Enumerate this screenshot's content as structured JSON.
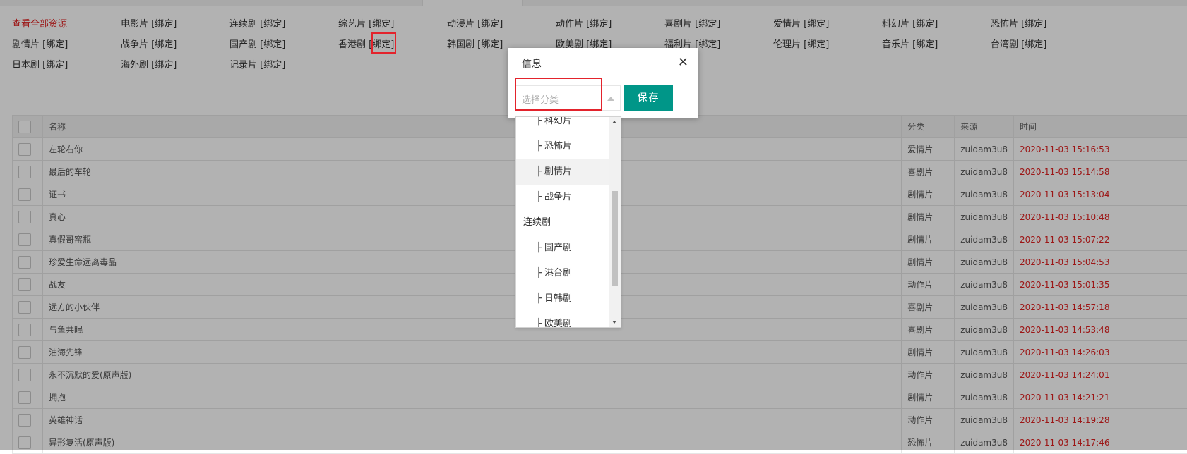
{
  "categories": [
    {
      "name": "查看全部资源",
      "bind": "",
      "active": true
    },
    {
      "name": "电影片",
      "bind": "[绑定]"
    },
    {
      "name": "连续剧",
      "bind": "[绑定]"
    },
    {
      "name": "综艺片",
      "bind": "[绑定]"
    },
    {
      "name": "动漫片",
      "bind": "[绑定]"
    },
    {
      "name": "动作片",
      "bind": "[绑定]"
    },
    {
      "name": "喜剧片",
      "bind": "[绑定]"
    },
    {
      "name": "爱情片",
      "bind": "[绑定]"
    },
    {
      "name": "科幻片",
      "bind": "[绑定]"
    },
    {
      "name": "恐怖片",
      "bind": "[绑定]"
    },
    {
      "name": "剧情片",
      "bind": "[绑定]"
    },
    {
      "name": "战争片",
      "bind": "[绑定]"
    },
    {
      "name": "国产剧",
      "bind": "[绑定]"
    },
    {
      "name": "香港剧",
      "bind": "[绑定]"
    },
    {
      "name": "韩国剧",
      "bind": "[绑定]"
    },
    {
      "name": "欧美剧",
      "bind": "[绑定]"
    },
    {
      "name": "福利片",
      "bind": "[绑定]"
    },
    {
      "name": "伦理片",
      "bind": "[绑定]"
    },
    {
      "name": "音乐片",
      "bind": "[绑定]"
    },
    {
      "name": "台湾剧",
      "bind": "[绑定]"
    },
    {
      "name": "日本剧",
      "bind": "[绑定]"
    },
    {
      "name": "海外剧",
      "bind": "[绑定]"
    },
    {
      "name": "记录片",
      "bind": "[绑定]"
    }
  ],
  "table": {
    "headers": {
      "name": "名称",
      "category": "分类",
      "source": "来源",
      "time": "时间"
    },
    "rows": [
      {
        "name": "左轮右你",
        "category": "爱情片",
        "source": "zuidam3u8",
        "time": "2020-11-03 15:16:53"
      },
      {
        "name": "最后的车轮",
        "category": "喜剧片",
        "source": "zuidam3u8",
        "time": "2020-11-03 15:14:58"
      },
      {
        "name": "证书",
        "category": "剧情片",
        "source": "zuidam3u8",
        "time": "2020-11-03 15:13:04"
      },
      {
        "name": "真心",
        "category": "剧情片",
        "source": "zuidam3u8",
        "time": "2020-11-03 15:10:48"
      },
      {
        "name": "真假哥窑瓶",
        "category": "剧情片",
        "source": "zuidam3u8",
        "time": "2020-11-03 15:07:22"
      },
      {
        "name": "珍爱生命远离毒品",
        "category": "剧情片",
        "source": "zuidam3u8",
        "time": "2020-11-03 15:04:53"
      },
      {
        "name": "战友",
        "category": "动作片",
        "source": "zuidam3u8",
        "time": "2020-11-03 15:01:35"
      },
      {
        "name": "远方的小伙伴",
        "category": "喜剧片",
        "source": "zuidam3u8",
        "time": "2020-11-03 14:57:18"
      },
      {
        "name": "与鱼共眠",
        "category": "喜剧片",
        "source": "zuidam3u8",
        "time": "2020-11-03 14:53:48"
      },
      {
        "name": "油海先锋",
        "category": "剧情片",
        "source": "zuidam3u8",
        "time": "2020-11-03 14:26:03"
      },
      {
        "name": "永不沉默的爱(原声版)",
        "category": "动作片",
        "source": "zuidam3u8",
        "time": "2020-11-03 14:24:01"
      },
      {
        "name": "拥抱",
        "category": "剧情片",
        "source": "zuidam3u8",
        "time": "2020-11-03 14:21:21"
      },
      {
        "name": "英雄神话",
        "category": "动作片",
        "source": "zuidam3u8",
        "time": "2020-11-03 14:19:28"
      },
      {
        "name": "异形复活(原声版)",
        "category": "恐怖片",
        "source": "zuidam3u8",
        "time": "2020-11-03 14:17:46"
      }
    ]
  },
  "dialog": {
    "title": "信息",
    "close_icon": "✕",
    "select_placeholder": "选择分类",
    "save_label": "保存",
    "options": [
      {
        "label": "├ 科幻片",
        "type": "child"
      },
      {
        "label": "├ 恐怖片",
        "type": "child"
      },
      {
        "label": "├ 剧情片",
        "type": "child",
        "hover": true
      },
      {
        "label": "├ 战争片",
        "type": "child"
      },
      {
        "label": "连续剧",
        "type": "group"
      },
      {
        "label": "├ 国产剧",
        "type": "child"
      },
      {
        "label": "├ 港台剧",
        "type": "child"
      },
      {
        "label": "├ 日韩剧",
        "type": "child"
      },
      {
        "label": "├ 欧美剧",
        "type": "child"
      }
    ]
  },
  "colors": {
    "accent": "#009688",
    "highlight": "#e3232c",
    "time_text": "#e02020"
  }
}
